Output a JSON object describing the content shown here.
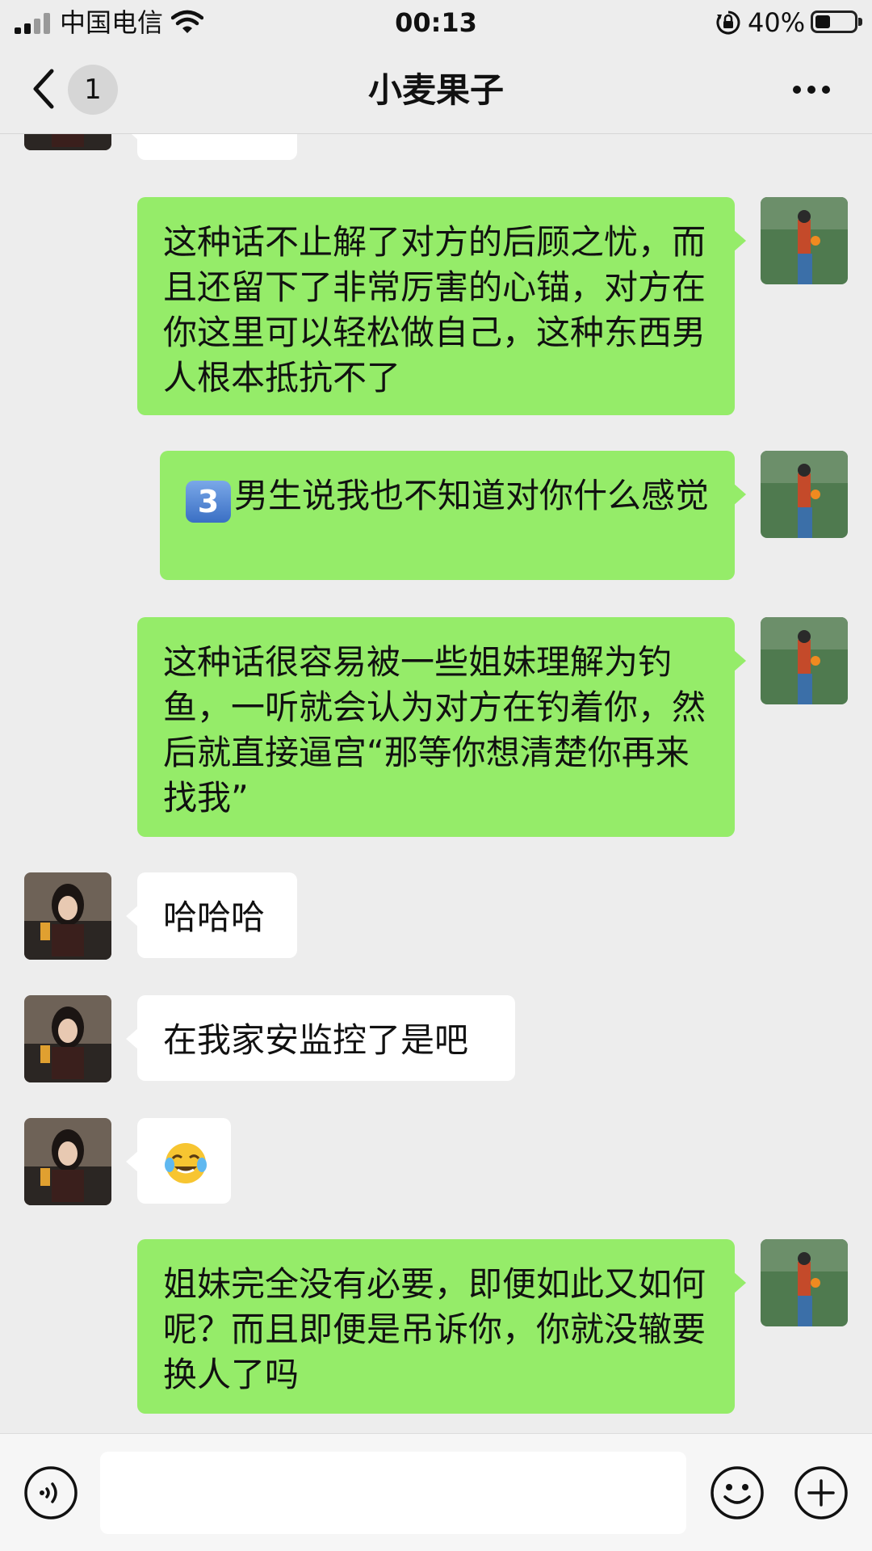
{
  "status_bar": {
    "carrier": "中国电信",
    "time": "00:13",
    "battery": "40%",
    "battery_level": 0.4
  },
  "header": {
    "unread_count": "1",
    "title": "小麦果子"
  },
  "messages": [
    {
      "side": "incoming",
      "text": ""
    },
    {
      "side": "outgoing",
      "text": "这种话不止解了对方的后顾之忧，而且还留下了非常厉害的心锚，对方在你这里可以轻松做自己，这种东西男人根本抵抗不了"
    },
    {
      "side": "outgoing",
      "emoji": "3",
      "text": "男生说我也不知道对你什么感觉"
    },
    {
      "side": "outgoing",
      "text": "这种话很容易被一些姐妹理解为钓鱼，一听就会认为对方在钓着你，然后就直接逼宫“那等你想清楚你再来找我”"
    },
    {
      "side": "incoming",
      "text": "哈哈哈"
    },
    {
      "side": "incoming",
      "text": "在我家安监控了是吧"
    },
    {
      "side": "incoming",
      "emoji": "face-with-tears-of-joy"
    },
    {
      "side": "outgoing",
      "text": "姐妹完全没有必要，即便如此又如何呢？而且即便是吊诉你，你就没辙要换人了吗"
    }
  ],
  "icons": {
    "signal": "signal-icon",
    "wifi": "wifi-icon",
    "lock": "rotation-lock-icon",
    "back": "chevron-left-icon",
    "more": "more-icon",
    "voice": "voice-icon",
    "emoji": "emoji-icon",
    "plus": "plus-icon"
  },
  "colors": {
    "outgoing_bubble": "#95ec69",
    "incoming_bubble": "#ffffff",
    "background": "#ededed"
  }
}
